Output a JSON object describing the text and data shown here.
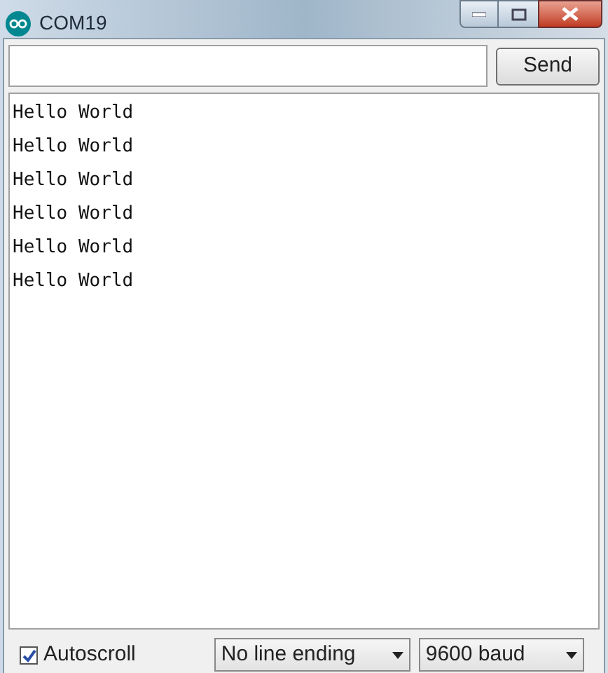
{
  "window": {
    "title": "COM19"
  },
  "send_button": {
    "label": "Send"
  },
  "output_lines": [
    "Hello World",
    "Hello World",
    "Hello World",
    "Hello World",
    "Hello World",
    "Hello World"
  ],
  "autoscroll": {
    "label": "Autoscroll",
    "checked": true
  },
  "line_ending": {
    "value": "No line ending"
  },
  "baud": {
    "value": "9600 baud"
  }
}
